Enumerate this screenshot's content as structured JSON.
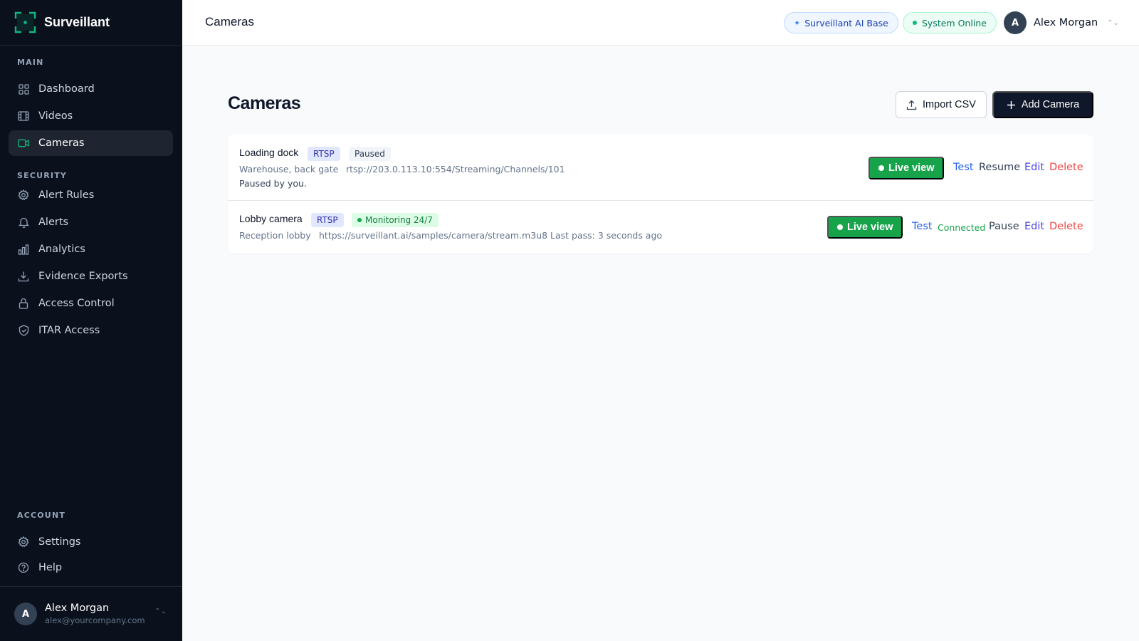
{
  "app": {
    "name": "Surveillant",
    "accent": "#10b981"
  },
  "sidebar": {
    "sections": {
      "main": "MAIN",
      "security": "SECURITY",
      "account": "ACCOUNT"
    },
    "main_items": [
      {
        "label": "Dashboard",
        "icon": "grid-icon"
      },
      {
        "label": "Videos",
        "icon": "film-icon"
      },
      {
        "label": "Cameras",
        "icon": "video-camera-icon",
        "active": true
      }
    ],
    "security_items": [
      {
        "label": "Alert Rules",
        "icon": "gear-icon"
      },
      {
        "label": "Alerts",
        "icon": "bell-icon"
      },
      {
        "label": "Analytics",
        "icon": "bar-chart-icon"
      },
      {
        "label": "Evidence Exports",
        "icon": "download-icon"
      },
      {
        "label": "Access Control",
        "icon": "lock-icon"
      },
      {
        "label": "ITAR Access",
        "icon": "shield-icon"
      }
    ],
    "account_items": [
      {
        "label": "Settings",
        "icon": "gear-icon"
      },
      {
        "label": "Help",
        "icon": "help-circle-icon"
      }
    ],
    "user": {
      "initial": "A",
      "name": "Alex Morgan",
      "email": "alex@yourcompany.com"
    }
  },
  "header": {
    "title": "Cameras",
    "ai_badge": "Surveillant AI Base",
    "status_badge": "System Online",
    "user_initial": "A",
    "user_name": "Alex Morgan"
  },
  "main": {
    "title": "Cameras",
    "import_label": "Import CSV",
    "add_label": "Add Camera",
    "cameras": [
      {
        "name": "Loading dock",
        "protocol": "RTSP",
        "status": "Paused",
        "location": "Warehouse, back gate",
        "url": "rtsp://203.0.113.10:554/Streaming/Channels/101",
        "note": "Paused by you.",
        "actions": {
          "live": "Live view",
          "test": "Test",
          "toggle": "Resume",
          "edit": "Edit",
          "delete": "Delete"
        }
      },
      {
        "name": "Lobby camera",
        "protocol": "RTSP",
        "status": "Monitoring 24/7",
        "location": "Reception lobby",
        "url": "https://surveillant.ai/samples/camera/stream.m3u8",
        "last_pass": "Last pass: 3 seconds ago",
        "actions": {
          "live": "Live view",
          "test": "Test",
          "connected": "Connected",
          "toggle": "Pause",
          "edit": "Edit",
          "delete": "Delete"
        }
      }
    ]
  }
}
